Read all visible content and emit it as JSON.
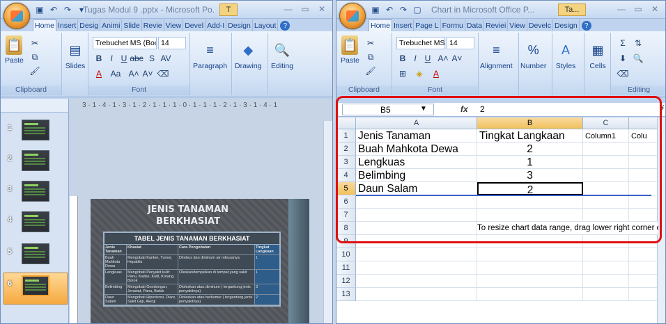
{
  "left_window": {
    "title": "Tugas Modul 9 .pptx - Microsoft Po...",
    "context_tab": "T",
    "tabs": [
      "Home",
      "Insert",
      "Design",
      "Animations",
      "Slide Show",
      "Review",
      "View",
      "Developer",
      "Add-Ins",
      "Design",
      "Layout"
    ],
    "tabs_short": [
      "Home",
      "Insert",
      "Desig",
      "Animi",
      "Slide",
      "Revie",
      "View",
      "Devel",
      "Add-I",
      "Design",
      "Layout"
    ],
    "clipboard": {
      "paste": "Paste",
      "label": "Clipboard"
    },
    "slides_btn": "Slides",
    "font": {
      "name": "Trebuchet MS (Boc",
      "size": "14",
      "label": "Font"
    },
    "paragraph": "Paragraph",
    "drawing": "Drawing",
    "editing": "Editing",
    "ruler": "3 · 1 · 4 · 1 · 3 · 1 · 2 · 1 · 1 · 1 · 0 · 1 · 1 · 1 · 2 · 1 · 3 · 1 · 4 · 1",
    "slide_numbers": [
      "1",
      "2",
      "3",
      "4",
      "5",
      "6"
    ],
    "slide": {
      "title_line1": "JENIS TANAMAN",
      "title_line2": "BERKHASIAT",
      "table_title": "TABEL JENIS TANAMAN BERKHASIAT",
      "rows": [
        [
          "Jenis Tanaman",
          "Khasiat",
          "Cara Pengobatan",
          "Tingkat Langkaan"
        ],
        [
          "Buah Mahkota Dewa",
          "Mengobati Kanker, Tumor, Hepatitis",
          "Direbus dan diminum air rebusanya",
          "1"
        ],
        [
          "Lengkuas",
          "Mengobati Penyakit kulit: Panu, Kadas, Kutil, Korang, Borok",
          "Oleskan/tempelkan di tempat yang sakit",
          "1"
        ],
        [
          "Belimbing",
          "Mengobati Gondongan, Jerawat, Panu, Batuk",
          "Dioleskan atau diminum ( tergantung jenis penyakitnya)",
          "3"
        ],
        [
          "Daun Salam",
          "Mengobati Hipertensi, Diare, Sakit Gigi, Alergi",
          "Dioleskan atau berkumur ( tergantung jenis penyakitnya)",
          "2"
        ]
      ]
    }
  },
  "right_window": {
    "title": "Chart in Microsoft Office P...",
    "context_tab": "Ta...",
    "tabs_short": [
      "Home",
      "Insert",
      "Page L",
      "Formu",
      "Data",
      "Reviei",
      "View",
      "Develc",
      "Design"
    ],
    "clipboard": {
      "paste": "Paste",
      "label": "Clipboard"
    },
    "font": {
      "name": "Trebuchet MS",
      "size": "14",
      "label": "Font"
    },
    "alignment": "Alignment",
    "number": "Number",
    "styles": "Styles",
    "cells": "Cells",
    "editing": "Editing",
    "name_box": "B5",
    "fx_label": "fx",
    "formula_value": "2",
    "columns": [
      "A",
      "B",
      "C"
    ],
    "col_d_partial": "Colu",
    "rows": [
      "1",
      "2",
      "3",
      "4",
      "5",
      "6",
      "7",
      "8",
      "9",
      "10",
      "11",
      "12",
      "13"
    ],
    "table": [
      [
        "Jenis Tanaman",
        "Tingkat Langkaan",
        "Column1"
      ],
      [
        "Buah Mahkota Dewa",
        "2",
        ""
      ],
      [
        "Lengkuas",
        "1",
        ""
      ],
      [
        "Belimbing",
        "3",
        ""
      ],
      [
        "Daun Salam",
        "2",
        ""
      ]
    ],
    "hint": "To resize chart data range, drag lower right corner of range."
  },
  "colors": {
    "accent_red": "#e01010",
    "ribbon_blue": "#bfd3ee",
    "selected_orange": "#f5a940"
  }
}
